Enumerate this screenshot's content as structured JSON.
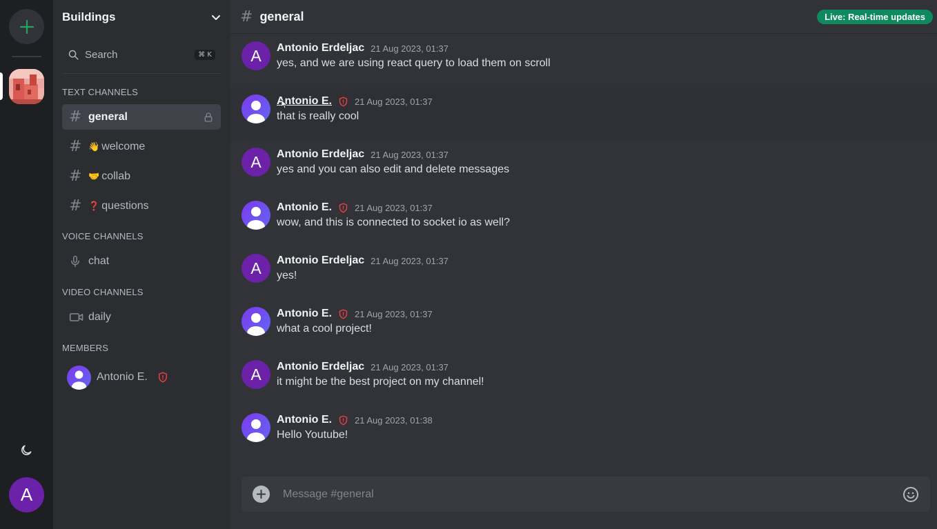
{
  "server": {
    "name": "Buildings"
  },
  "search": {
    "label": "Search",
    "shortcut": "⌘ K"
  },
  "sections": {
    "text": "TEXT CHANNELS",
    "voice": "VOICE CHANNELS",
    "video": "VIDEO CHANNELS",
    "members": "MEMBERS"
  },
  "channels": {
    "general": {
      "name": "general"
    },
    "welcome": {
      "emoji": "👋",
      "name": "welcome"
    },
    "collab": {
      "emoji": "🤝",
      "name": "collab"
    },
    "questions": {
      "emoji": "❓",
      "name": "questions"
    },
    "voice_chat": {
      "name": "chat"
    },
    "video_daily": {
      "name": "daily"
    }
  },
  "members": [
    {
      "name": "Antonio E.",
      "role_icon": "shield-icon"
    }
  ],
  "user": {
    "initial": "A"
  },
  "header": {
    "channel": "general",
    "live_badge": "Live: Real-time updates"
  },
  "messages": [
    {
      "avatar": "A",
      "author": "Antonio Erdeljac",
      "time": "21 Aug 2023, 01:37",
      "text": "yes, and we are using react query to load them on scroll"
    },
    {
      "avatar": "default",
      "author": "Antonio E.",
      "time": "21 Aug 2023, 01:37",
      "text": "that is really cool"
    },
    {
      "avatar": "A",
      "author": "Antonio Erdeljac",
      "time": "21 Aug 2023, 01:37",
      "text": "yes and you can also edit and delete messages"
    },
    {
      "avatar": "default",
      "author": "Antonio E.",
      "time": "21 Aug 2023, 01:37",
      "text": "wow, and this is connected to socket io as well?"
    },
    {
      "avatar": "A",
      "author": "Antonio Erdeljac",
      "time": "21 Aug 2023, 01:37",
      "text": "yes!"
    },
    {
      "avatar": "default",
      "author": "Antonio E.",
      "time": "21 Aug 2023, 01:37",
      "text": "what a cool project!"
    },
    {
      "avatar": "A",
      "author": "Antonio Erdeljac",
      "time": "21 Aug 2023, 01:37",
      "text": "it might be the best project on my channel!"
    },
    {
      "avatar": "default",
      "author": "Antonio E.",
      "time": "21 Aug 2023, 01:38",
      "text": "Hello Youtube!"
    }
  ],
  "composer": {
    "placeholder": "Message #general"
  },
  "colors": {
    "accent_green": "#23a55a",
    "live_badge": "#0f8a5f",
    "avatar_purple": "#6b21a8",
    "moderator_shield": "#f23f43"
  }
}
